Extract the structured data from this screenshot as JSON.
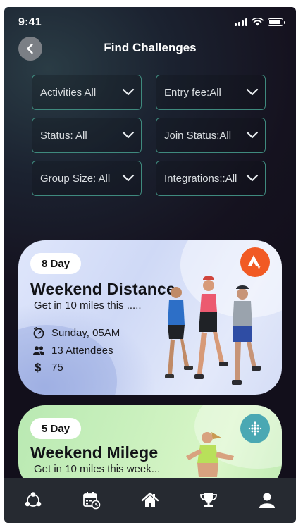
{
  "status_bar": {
    "time": "9:41"
  },
  "header": {
    "title": "Find Challenges",
    "back_icon": "chevron-left-icon"
  },
  "filters": [
    {
      "label": "Activities All"
    },
    {
      "label": "Entry fee:All"
    },
    {
      "label": "Status: All"
    },
    {
      "label": "Join Status:All"
    },
    {
      "label": "Group Size: All"
    },
    {
      "label": "Integrations::All"
    }
  ],
  "challenges": [
    {
      "duration": "8 Day",
      "title": "Weekend Distance",
      "subtitle": "Get in 10 miles this .....",
      "date": "Sunday, 05AM",
      "attendees": "13 Attendees",
      "fee": "75",
      "integration_icon": "strava-icon",
      "integration_color": "#f15a24"
    },
    {
      "duration": "5 Day",
      "title": "Weekend Milege",
      "subtitle": "Get in 10 miles this week...",
      "integration_icon": "fitbit-icon",
      "integration_color": "#4aa8b3"
    }
  ],
  "nav": [
    {
      "icon": "community-icon"
    },
    {
      "icon": "calendar-icon"
    },
    {
      "icon": "home-icon"
    },
    {
      "icon": "trophy-icon"
    },
    {
      "icon": "profile-icon"
    }
  ],
  "colors": {
    "filter_border": "#3f8a7e",
    "navbar": "#262a31"
  }
}
